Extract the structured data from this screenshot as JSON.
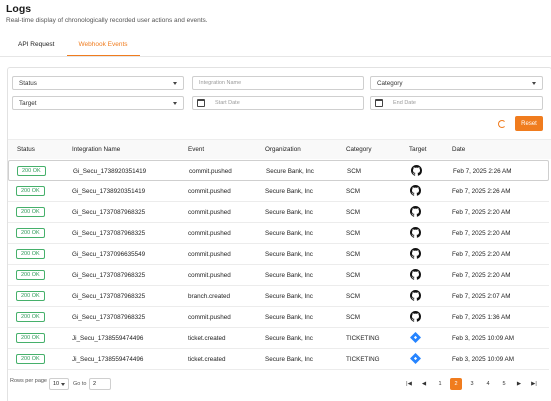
{
  "page": {
    "title": "Logs",
    "subtitle": "Real-time display of chronologically recorded user actions and events."
  },
  "tabs": [
    {
      "label": "API Request",
      "active": false
    },
    {
      "label": "Webhook Events",
      "active": true
    }
  ],
  "filters": {
    "status": "Status",
    "integration_placeholder": "Integration Name",
    "category": "Category",
    "target": "Target",
    "start_date_placeholder": "Start Date",
    "end_date_placeholder": "End Date"
  },
  "actions": {
    "reset_label": "Reset"
  },
  "table": {
    "headers": [
      "Status",
      "Integration Name",
      "Event",
      "Organization",
      "Category",
      "Target",
      "Date"
    ],
    "rows": [
      {
        "status": "200 OK",
        "integration": "Gi_Secu_1738920351419",
        "event": "commit.pushed",
        "org": "Secure Bank, Inc",
        "category": "SCM",
        "target": "github-icon",
        "date": "Feb 7, 2025 2:26 AM"
      },
      {
        "status": "200 OK",
        "integration": "Gi_Secu_1738920351419",
        "event": "commit.pushed",
        "org": "Secure Bank, Inc",
        "category": "SCM",
        "target": "github-icon",
        "date": "Feb 7, 2025 2:26 AM"
      },
      {
        "status": "200 OK",
        "integration": "Gi_Secu_1737087968325",
        "event": "commit.pushed",
        "org": "Secure Bank, Inc",
        "category": "SCM",
        "target": "github-icon",
        "date": "Feb 7, 2025 2:20 AM"
      },
      {
        "status": "200 OK",
        "integration": "Gi_Secu_1737087968325",
        "event": "commit.pushed",
        "org": "Secure Bank, Inc",
        "category": "SCM",
        "target": "github-icon",
        "date": "Feb 7, 2025 2:20 AM"
      },
      {
        "status": "200 OK",
        "integration": "Gi_Secu_1737096635549",
        "event": "commit.pushed",
        "org": "Secure Bank, Inc",
        "category": "SCM",
        "target": "github-icon",
        "date": "Feb 7, 2025 2:20 AM"
      },
      {
        "status": "200 OK",
        "integration": "Gi_Secu_1737087968325",
        "event": "commit.pushed",
        "org": "Secure Bank, Inc",
        "category": "SCM",
        "target": "github-icon",
        "date": "Feb 7, 2025 2:20 AM"
      },
      {
        "status": "200 OK",
        "integration": "Gi_Secu_1737087968325",
        "event": "branch.created",
        "org": "Secure Bank, Inc",
        "category": "SCM",
        "target": "github-icon",
        "date": "Feb 7, 2025 2:07 AM"
      },
      {
        "status": "200 OK",
        "integration": "Gi_Secu_1737087968325",
        "event": "commit.pushed",
        "org": "Secure Bank, Inc",
        "category": "SCM",
        "target": "github-icon",
        "date": "Feb 7, 2025 1:36 AM"
      },
      {
        "status": "200 OK",
        "integration": "Ji_Secu_1738559474496",
        "event": "ticket.created",
        "org": "Secure Bank, Inc",
        "category": "TICKETING",
        "target": "jira-icon",
        "date": "Feb 3, 2025 10:09 AM"
      },
      {
        "status": "200 OK",
        "integration": "Ji_Secu_1738559474496",
        "event": "ticket.created",
        "org": "Secure Bank, Inc",
        "category": "TICKETING",
        "target": "jira-icon",
        "date": "Feb 3, 2025 10:09 AM"
      }
    ]
  },
  "pagination": {
    "rows_per_page_label": "Rows per page",
    "rows_per_page_value": "10",
    "goto_label": "Go to",
    "goto_value": "2",
    "pages": [
      "1",
      "2",
      "3",
      "4",
      "5"
    ],
    "current_page": "2",
    "first": "|◀",
    "prev": "◀",
    "next": "▶",
    "last": "▶|"
  },
  "colors": {
    "accent": "#f07c1e",
    "success": "#46b06b",
    "jira": "#2684ff"
  }
}
